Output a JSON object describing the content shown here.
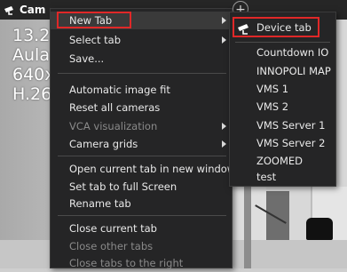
{
  "camera_overlay": {
    "line1": "13.2",
    "line2": "Aula",
    "line3": "640x",
    "line4": "H.26"
  },
  "tabbar": {
    "active_tab_label": "Cam",
    "add_tab_symbol": "+"
  },
  "context_menu": {
    "items": [
      {
        "label": "New Tab",
        "has_submenu": true,
        "enabled": true,
        "highlighted": true
      },
      {
        "label": "Select tab",
        "has_submenu": true,
        "enabled": true
      },
      {
        "label": "Save...",
        "has_submenu": false,
        "enabled": true
      },
      {
        "label": "Automatic image fit",
        "has_submenu": false,
        "enabled": true
      },
      {
        "label": "Reset all cameras",
        "has_submenu": false,
        "enabled": true
      },
      {
        "label": "VCA visualization",
        "has_submenu": true,
        "enabled": false
      },
      {
        "label": "Camera grids",
        "has_submenu": true,
        "enabled": true
      },
      {
        "label": "Open current tab in new window",
        "has_submenu": false,
        "enabled": true
      },
      {
        "label": "Set tab to full Screen",
        "has_submenu": false,
        "enabled": true
      },
      {
        "label": "Rename tab",
        "has_submenu": false,
        "enabled": true
      },
      {
        "label": "Close current tab",
        "has_submenu": false,
        "enabled": true
      },
      {
        "label": "Close other tabs",
        "has_submenu": false,
        "enabled": false
      },
      {
        "label": "Close tabs to the right",
        "has_submenu": false,
        "enabled": false
      }
    ]
  },
  "new_tab_submenu": {
    "items": [
      {
        "label": "Device tab",
        "icon": "camera-icon",
        "highlighted": true
      },
      {
        "label": "Countdown IO"
      },
      {
        "label": "INNOPOLI MAP"
      },
      {
        "label": "VMS 1"
      },
      {
        "label": "VMS 2"
      },
      {
        "label": "VMS Server 1"
      },
      {
        "label": "VMS Server 2"
      },
      {
        "label": "ZOOMED"
      },
      {
        "label": "test"
      }
    ]
  },
  "colors": {
    "menu_bg": "#252526",
    "menu_text": "#e9e9e9",
    "menu_text_disabled": "#8a8a8a",
    "highlight_box": "#e02828"
  }
}
